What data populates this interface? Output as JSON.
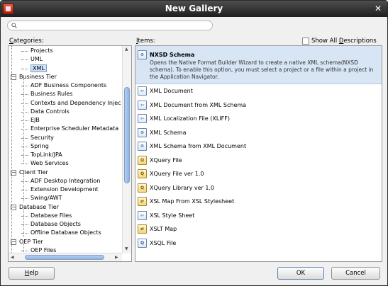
{
  "window": {
    "title": "New Gallery",
    "close_glyph": "✕"
  },
  "search": {
    "value": "",
    "placeholder": ""
  },
  "categories": {
    "label": "Categories:",
    "label_prefix": "C",
    "label_rest": "ategories:",
    "tree": [
      {
        "label": "Projects",
        "level": 1
      },
      {
        "label": "UML",
        "level": 1
      },
      {
        "label": "XML",
        "level": 1,
        "selected": true
      },
      {
        "label": "Business Tier",
        "level": 0,
        "expanded": true
      },
      {
        "label": "ADF Business Components",
        "level": 1
      },
      {
        "label": "Business Rules",
        "level": 1
      },
      {
        "label": "Contexts and Dependency Injec",
        "level": 1
      },
      {
        "label": "Data Controls",
        "level": 1
      },
      {
        "label": "EJB",
        "level": 1
      },
      {
        "label": "Enterprise Scheduler Metadata",
        "level": 1
      },
      {
        "label": "Security",
        "level": 1
      },
      {
        "label": "Spring",
        "level": 1
      },
      {
        "label": "TopLink/JPA",
        "level": 1
      },
      {
        "label": "Web Services",
        "level": 1
      },
      {
        "label": "Client Tier",
        "level": 0,
        "expanded": true
      },
      {
        "label": "ADF Desktop Integration",
        "level": 1
      },
      {
        "label": "Extension Development",
        "level": 1
      },
      {
        "label": "Swing/AWT",
        "level": 1
      },
      {
        "label": "Database Tier",
        "level": 0,
        "expanded": true
      },
      {
        "label": "Database Files",
        "level": 1
      },
      {
        "label": "Database Objects",
        "level": 1
      },
      {
        "label": "Offline Database Objects",
        "level": 1
      },
      {
        "label": "OEP Tier",
        "level": 0,
        "expanded": true
      },
      {
        "label": "OEP Files",
        "level": 1
      }
    ]
  },
  "items": {
    "label_prefix": "I",
    "label_rest": "tems:",
    "show_all": {
      "label_prefix": "Show All ",
      "mnemonic": "D",
      "label_rest": "escriptions",
      "checked": false
    },
    "selected_description": "Opens the Native Format Builder Wizard to create a native XML schema(NXSD schema). To enable this option, you must select a project or a file within a project in the Application Navigator.",
    "list": [
      {
        "name": "NXSD Schema",
        "icon": "nxsd-schema-icon",
        "selected": true
      },
      {
        "name": "XML Document",
        "icon": "xml-document-icon"
      },
      {
        "name": "XML Document from XML Schema",
        "icon": "xml-document-icon"
      },
      {
        "name": "XML Localization File (XLIFF)",
        "icon": "xliff-icon"
      },
      {
        "name": "XML Schema",
        "icon": "xml-schema-icon"
      },
      {
        "name": "XML Schema from XML Document",
        "icon": "xml-schema-icon"
      },
      {
        "name": "XQuery File",
        "icon": "xquery-icon"
      },
      {
        "name": "XQuery File ver 1.0",
        "icon": "xquery-icon"
      },
      {
        "name": "XQuery Library ver 1.0",
        "icon": "xquery-library-icon"
      },
      {
        "name": "XSL Map From XSL Stylesheet",
        "icon": "xsl-map-icon"
      },
      {
        "name": "XSL Style Sheet",
        "icon": "xsl-stylesheet-icon"
      },
      {
        "name": "XSLT Map",
        "icon": "xslt-map-icon"
      },
      {
        "name": "XSQL File",
        "icon": "xsql-icon"
      }
    ]
  },
  "buttons": {
    "help": {
      "mnemonic": "H",
      "rest": "elp"
    },
    "ok": "OK",
    "cancel": "Cancel"
  }
}
